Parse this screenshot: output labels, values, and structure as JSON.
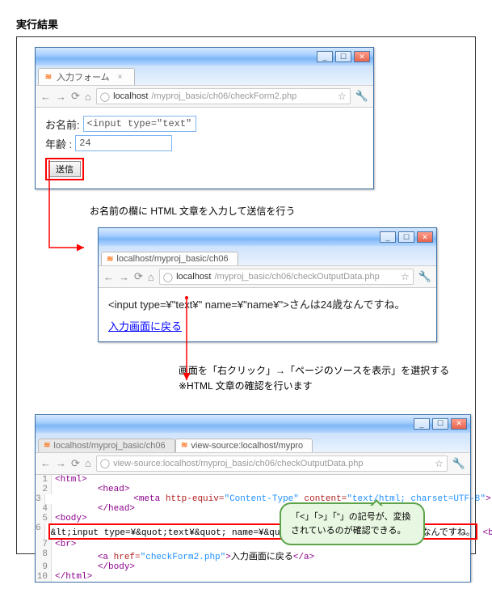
{
  "heading": "実行結果",
  "browser1": {
    "tab_title": "入力フォーム",
    "url_host": "localhost",
    "url_path": "/myproj_basic/ch06/checkForm2.php",
    "label_name": "お名前:",
    "input_name_value": "<input type=\"text\" name=",
    "label_age": "年齢  :",
    "input_age_value": "24",
    "submit_label": "送信"
  },
  "annotation1": "お名前の欄に HTML 文章を入力して送信を行う",
  "browser2": {
    "tab_title": "localhost/myproj_basic/ch06",
    "url_host": "localhost",
    "url_path": "/myproj_basic/ch06/checkOutputData.php",
    "body_text": "<input type=¥\"text¥\" name=¥\"name¥\">さんは24歳なんですね。",
    "back_link": "入力画面に戻る"
  },
  "annotation2a": "画面を「右クリック」→「ページのソースを表示」を選択する",
  "annotation2b": "※HTML 文章の確認を行います",
  "browser3": {
    "tab1_title": "localhost/myproj_basic/ch06",
    "tab2_title": "view-source:localhost/mypro",
    "url_full": "view-source:localhost/myproj_basic/ch06/checkOutputData.php",
    "src": {
      "l1": "<html>",
      "l2_indent": "        ",
      "l2": "<head>",
      "l3_indent": "                ",
      "l3_tag": "<meta",
      "l3_a1n": " http-equiv=",
      "l3_a1v": "\"Content-Type\"",
      "l3_a2n": " content=",
      "l3_a2v": "\"text/html; charset=UTF-8\"",
      "l3_end": ">",
      "l4_indent": "        ",
      "l4": "</head>",
      "l5": "<body>",
      "l6_text": "&lt;input type=¥&quot;text¥&quot; name=¥&quot;name¥&quot;&gt;さんは24歳なんですね。",
      "l6_br": "<br>",
      "l7": "<br>",
      "l8_indent": "        ",
      "l8_open": "<a",
      "l8_attr_n": " href=",
      "l8_attr_v": "\"checkForm2.php\"",
      "l8_close": ">",
      "l8_text": "入力画面に戻る",
      "l8_end": "</a>",
      "l9_indent": "        ",
      "l9": "</body>",
      "l10": "</html>"
    }
  },
  "speech": "「<」「>」「\"」の記号が、変換されているのが確認できる。",
  "win": {
    "min": "_",
    "max": "☐",
    "close": "✕"
  },
  "icons": {
    "back": "←",
    "fwd": "→",
    "reload": "⟳",
    "home": "⌂",
    "star": "☆",
    "wrench": "🔧",
    "globe": "◯",
    "tabx": "×"
  }
}
